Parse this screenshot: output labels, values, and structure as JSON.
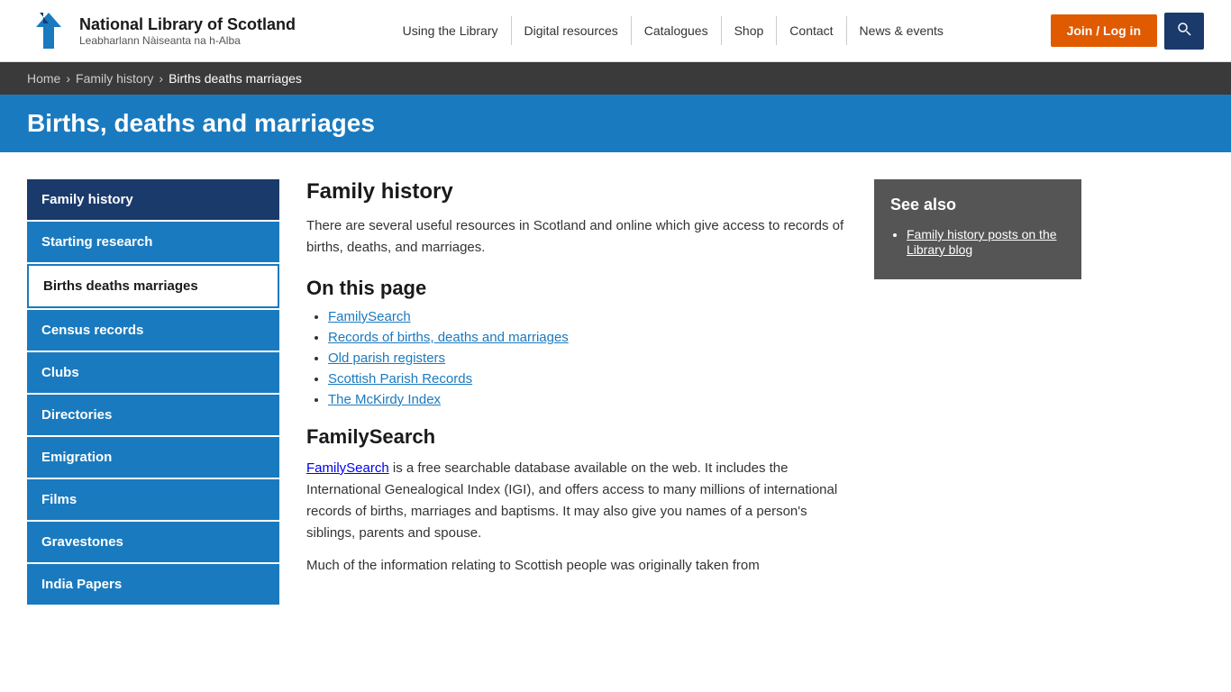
{
  "site": {
    "logo_title": "National Library of Scotland",
    "logo_subtitle": "Leabharlann Nàiseanta na h-Alba"
  },
  "top_nav": {
    "items": [
      {
        "label": "Using the Library",
        "href": "#"
      },
      {
        "label": "Digital resources",
        "href": "#"
      },
      {
        "label": "Catalogues",
        "href": "#"
      },
      {
        "label": "Shop",
        "href": "#"
      },
      {
        "label": "Contact",
        "href": "#"
      },
      {
        "label": "News & events",
        "href": "#"
      }
    ]
  },
  "header_actions": {
    "join_label": "Join / Log in",
    "search_icon": "🔍"
  },
  "breadcrumb": {
    "items": [
      {
        "label": "Home",
        "href": "#"
      },
      {
        "label": "Family history",
        "href": "#"
      },
      {
        "label": "Births deaths marriages",
        "href": "#"
      }
    ]
  },
  "page_title": "Births, deaths and marriages",
  "sidebar": {
    "items": [
      {
        "label": "Family history",
        "type": "dark",
        "href": "#"
      },
      {
        "label": "Starting research",
        "type": "blue",
        "href": "#"
      },
      {
        "label": "Births deaths marriages",
        "type": "current",
        "href": "#"
      },
      {
        "label": "Census records",
        "type": "blue",
        "href": "#"
      },
      {
        "label": "Clubs",
        "type": "blue",
        "href": "#"
      },
      {
        "label": "Directories",
        "type": "blue",
        "href": "#"
      },
      {
        "label": "Emigration",
        "type": "blue",
        "href": "#"
      },
      {
        "label": "Films",
        "type": "blue",
        "href": "#"
      },
      {
        "label": "Gravestones",
        "type": "blue",
        "href": "#"
      },
      {
        "label": "India Papers",
        "type": "blue",
        "href": "#"
      }
    ]
  },
  "main_content": {
    "section_title": "Family history",
    "intro": "There are several useful resources in Scotland and online which give access to records of births, deaths, and marriages.",
    "on_this_page_title": "On this page",
    "on_this_page_links": [
      {
        "label": "FamilySearch",
        "href": "#familysearch"
      },
      {
        "label": "Records of births, deaths and marriages",
        "href": "#records"
      },
      {
        "label": "Old parish registers",
        "href": "#old-parish"
      },
      {
        "label": "Scottish Parish Records",
        "href": "#scottish-parish"
      },
      {
        "label": "The McKirdy Index",
        "href": "#mckirdy"
      }
    ],
    "familysearch_title": "FamilySearch",
    "familysearch_link_label": "FamilySearch",
    "familysearch_desc1": " is a free searchable database available on the web. It includes the International Genealogical Index (IGI), and offers access to many millions of international records of births, marriages and baptisms. It may also give you names of a person's siblings, parents and spouse.",
    "familysearch_desc2": "Much of the information relating to Scottish people was originally taken from"
  },
  "see_also": {
    "title": "See also",
    "links": [
      {
        "label": "Family history posts on the Library blog",
        "href": "#"
      }
    ]
  }
}
